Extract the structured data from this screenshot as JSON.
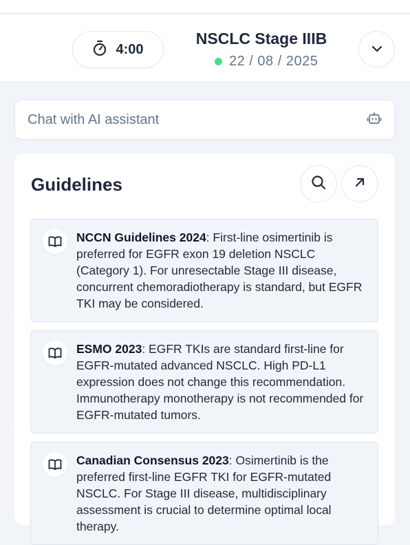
{
  "header": {
    "timer": "4:00",
    "case_title": "NSCLC Stage IIIB",
    "case_date": "22 / 08 / 2025",
    "status_color": "#4ade80"
  },
  "chat": {
    "placeholder": "Chat with AI assistant",
    "value": ""
  },
  "guidelines": {
    "title": "Guidelines",
    "items": [
      {
        "source": "NCCN Guidelines 2024",
        "text": ": First-line osimertinib is preferred for EGFR exon 19 deletion NSCLC (Category 1). For unresectable Stage III disease, concurrent chemoradiotherapy is standard, but EGFR TKI may be considered."
      },
      {
        "source": "ESMO 2023",
        "text": ": EGFR TKIs are standard first-line for EGFR-mutated advanced NSCLC. High PD-L1 expression does not change this recommendation. Immunotherapy monotherapy is not recommended for EGFR-mutated tumors."
      },
      {
        "source": "Canadian Consensus 2023",
        "text": ": Osimertinib is the preferred first-line EGFR TKI for EGFR-mutated NSCLC. For Stage III disease, multidisciplinary assessment is crucial to determine optimal local therapy."
      }
    ]
  },
  "icons": {
    "timer": "stopwatch-icon",
    "dropdown": "chevron-down-icon",
    "chat": "robot-icon",
    "search": "search-icon",
    "expand": "arrow-up-right-icon",
    "guideline": "book-open-icon"
  },
  "colors": {
    "accent_status": "#4ade80",
    "text_primary": "#1e293b",
    "text_muted": "#64748b",
    "card_bg": "#f1f5f9"
  }
}
